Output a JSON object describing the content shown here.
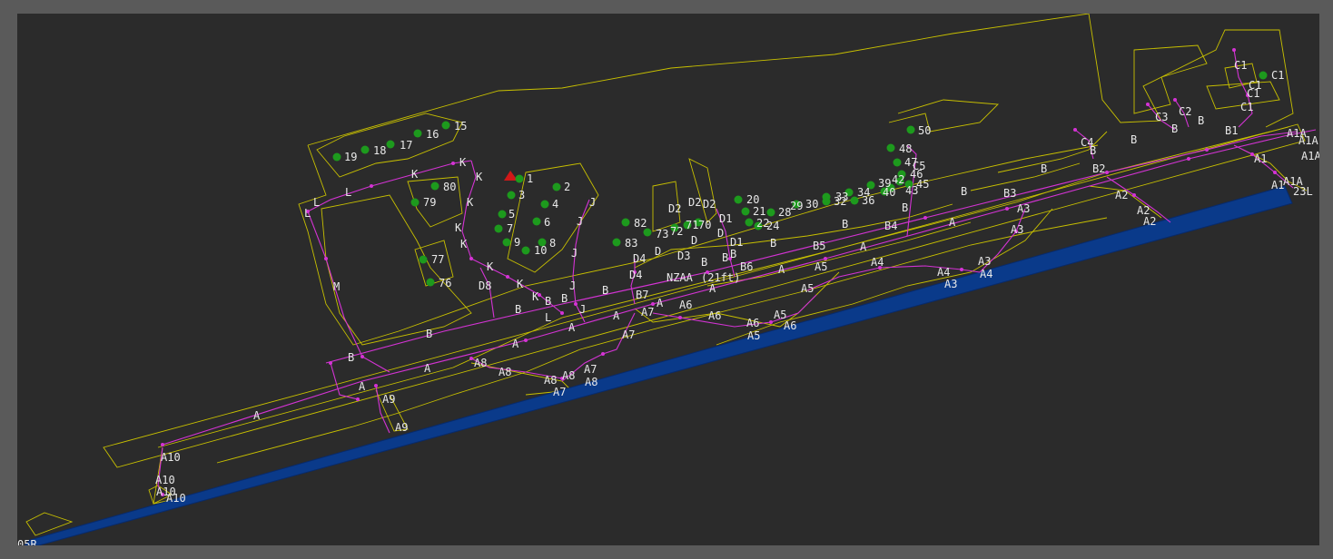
{
  "airport": {
    "code": "NZAA",
    "elevation": "(21ft)"
  },
  "runway": {
    "end_sw": "05R",
    "end_ne": "23L"
  },
  "colors": {
    "background": "#2b2b2b",
    "frame": "#5a5a5a",
    "outline": "#c8c000",
    "taxi": "#d433d4",
    "gate": "#1d9a1d",
    "runway": "#0a3a8a",
    "aircraft": "#d01818"
  },
  "aircraft_marker": "red-triangle",
  "gates": [
    "1",
    "2",
    "3",
    "4",
    "5",
    "6",
    "7",
    "8",
    "9",
    "10",
    "15",
    "16",
    "17",
    "18",
    "19",
    "20",
    "21",
    "22",
    "24",
    "28",
    "29",
    "30",
    "32",
    "33",
    "34",
    "36",
    "39",
    "40",
    "42",
    "43",
    "45",
    "46",
    "47",
    "48",
    "50",
    "70",
    "71",
    "72",
    "73",
    "76",
    "77",
    "79",
    "80",
    "82",
    "83",
    "C1"
  ],
  "taxiway_labels": [
    "A",
    "A",
    "A",
    "A",
    "A",
    "A",
    "A",
    "A",
    "A",
    "A",
    "A",
    "A1",
    "A1",
    "A1A",
    "A1A",
    "A1A",
    "A1A",
    "A2",
    "A2",
    "A2",
    "A3",
    "A3",
    "A3",
    "A3",
    "A4",
    "A4",
    "A4",
    "A5",
    "A5",
    "A5",
    "A5",
    "A6",
    "A6",
    "A6",
    "A6",
    "A7",
    "A7",
    "A7",
    "A7",
    "A8",
    "A8",
    "A8",
    "A8",
    "A8",
    "A9",
    "A9",
    "A10",
    "A10",
    "A10",
    "A10",
    "B",
    "B",
    "B",
    "B",
    "B",
    "B",
    "B",
    "B",
    "B",
    "B",
    "B",
    "B",
    "B",
    "B",
    "B",
    "B",
    "B",
    "B",
    "B1",
    "B2",
    "B3",
    "B4",
    "B5",
    "B6",
    "B7",
    "C1",
    "C1",
    "C1",
    "C1",
    "C2",
    "C3",
    "C4",
    "C5",
    "D",
    "D",
    "D",
    "D1",
    "D1",
    "D2",
    "D2",
    "D2",
    "D3",
    "D4",
    "D4",
    "D8",
    "J",
    "J",
    "J",
    "J",
    "J",
    "K",
    "K",
    "K",
    "K",
    "K",
    "K",
    "K",
    "K",
    "K",
    "L",
    "L",
    "L",
    "L",
    "M"
  ]
}
